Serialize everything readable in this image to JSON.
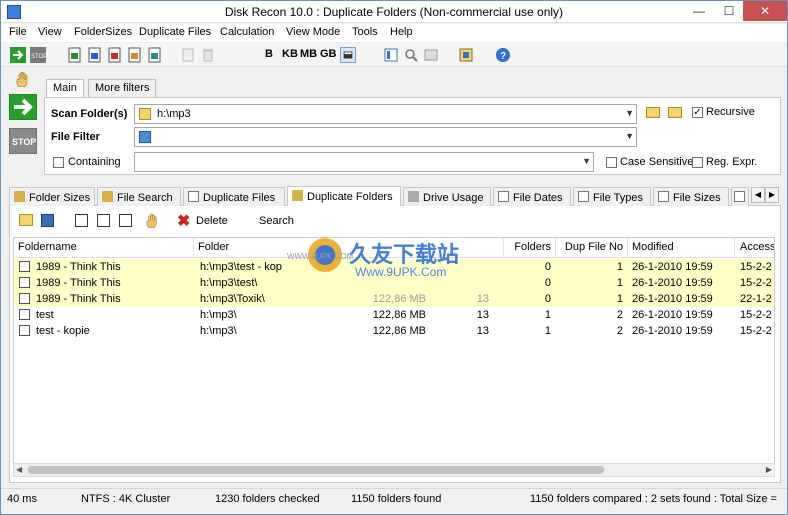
{
  "window": {
    "title": "Disk Recon 10.0 : Duplicate Folders  (Non-commercial use only)"
  },
  "menu": [
    "File",
    "View",
    "FolderSizes",
    "Duplicate Files",
    "Calculation",
    "View Mode",
    "Tools",
    "Help"
  ],
  "toolbar": {
    "unit_b": "B",
    "unit_kb": "KB",
    "unit_mb": "MB",
    "unit_gb": "GB"
  },
  "filter_tabs": [
    "Main",
    "More filters"
  ],
  "filters": {
    "scan_label": "Scan Folder(s)",
    "scan_value": "h:\\mp3",
    "recursive_label": "Recursive",
    "file_filter_label": "File Filter",
    "containing_label": "Containing",
    "case_sensitive_label": "Case Sensitive",
    "regexpr_label": "Reg. Expr."
  },
  "view_tabs": [
    "Folder Sizes",
    "File Search",
    "Duplicate Files",
    "Duplicate Folders",
    "Drive Usage",
    "File Dates",
    "File Types",
    "File Sizes"
  ],
  "actions": {
    "delete_label": "Delete",
    "search_label": "Search"
  },
  "columns": [
    "Foldername",
    "Folder",
    "",
    "",
    "Folders",
    "Dup File No",
    "Modified",
    "Access"
  ],
  "rows": [
    {
      "name": "1989 - Think This",
      "folder": "h:\\mp3\\test - kop",
      "size": "",
      "files": "",
      "folders": "0",
      "dup": "1",
      "modified": "26-1-2010 19:59",
      "access": "15-2-2",
      "dup_row": true
    },
    {
      "name": "1989 - Think This",
      "folder": "h:\\mp3\\test\\",
      "size": "",
      "files": "",
      "folders": "0",
      "dup": "1",
      "modified": "26-1-2010 19:59",
      "access": "15-2-2",
      "dup_row": true
    },
    {
      "name": "1989 - Think This",
      "folder": "h:\\mp3\\Toxik\\",
      "size": "122,86 MB",
      "files": "13",
      "folders": "0",
      "dup": "1",
      "modified": "26-1-2010 19:59",
      "access": "22-1-2",
      "dup_row": true
    },
    {
      "name": "test",
      "folder": "h:\\mp3\\",
      "size": "122,86 MB",
      "files": "13",
      "folders": "1",
      "dup": "2",
      "modified": "26-1-2010 19:59",
      "access": "15-2-2",
      "dup_row": false
    },
    {
      "name": "test - kopie",
      "folder": "h:\\mp3\\",
      "size": "122,86 MB",
      "files": "13",
      "folders": "1",
      "dup": "2",
      "modified": "26-1-2010 19:59",
      "access": "15-2-2",
      "dup_row": false
    }
  ],
  "watermark": {
    "text": "久友下载站",
    "sub": "Www.9UPK.Com",
    "url": "WWW.9UPK.COM"
  },
  "status": [
    "40 ms",
    "NTFS : 4K Cluster",
    "1230 folders checked",
    "1150 folders found",
    "1150 folders compared : 2 sets found : Total Size ="
  ],
  "colors": {
    "accent": "#2f6fd6",
    "duplicate_row": "#ffffc8",
    "close": "#c75050"
  }
}
